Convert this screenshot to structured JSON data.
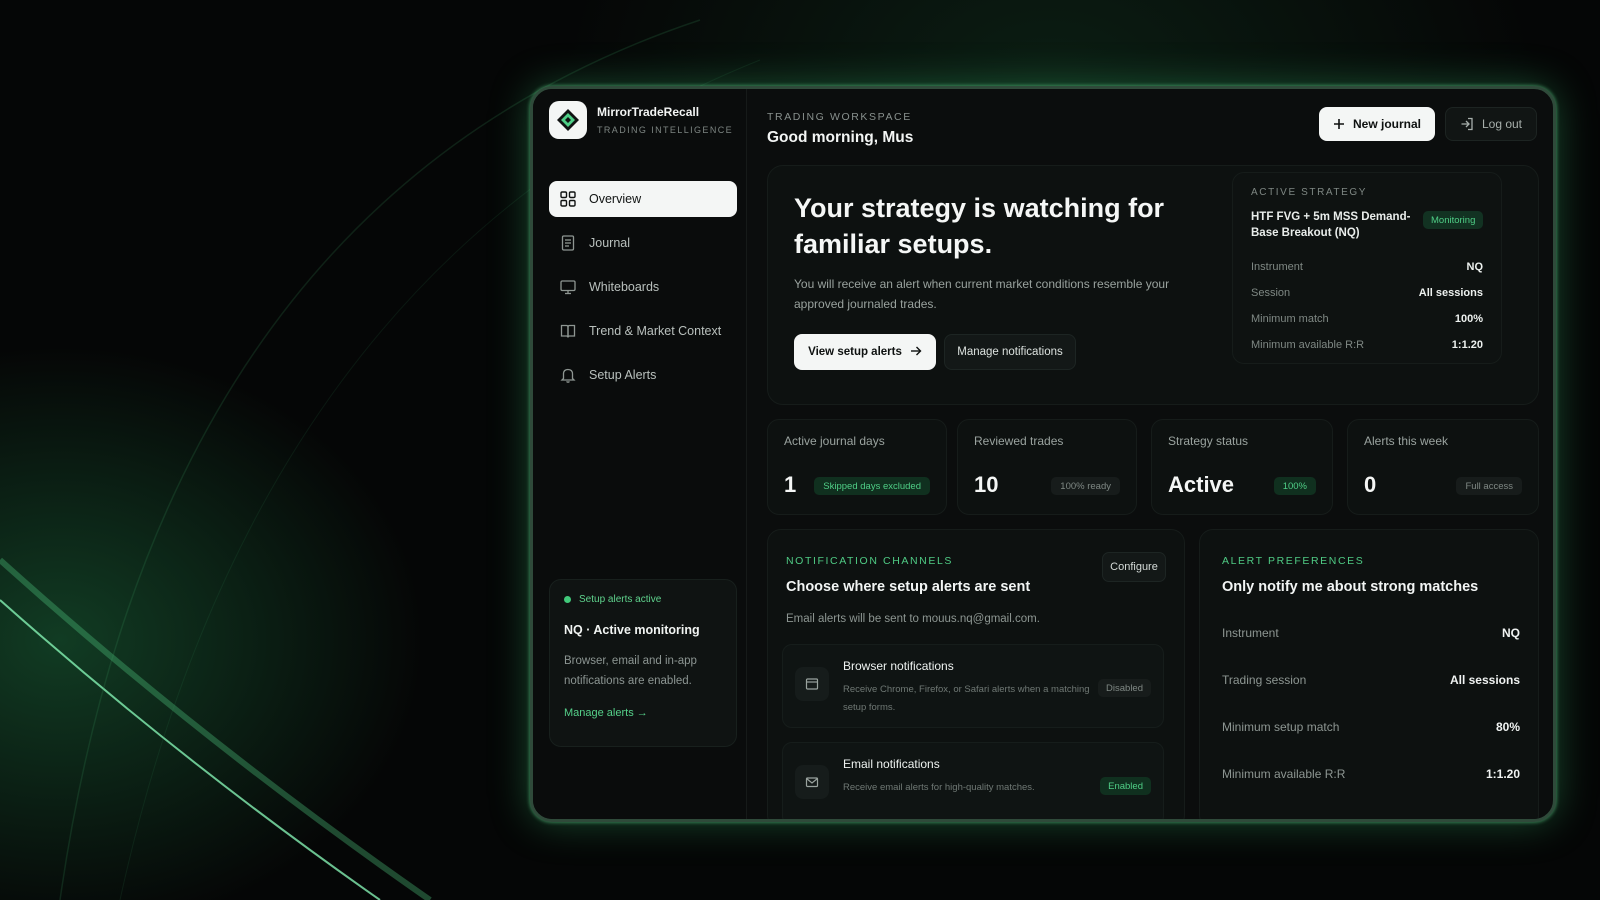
{
  "brand": {
    "name": "MirrorTradeRecall",
    "subtitle": "TRADING INTELLIGENCE"
  },
  "nav": [
    {
      "label": "Overview",
      "icon": "grid-icon",
      "active": true
    },
    {
      "label": "Journal",
      "icon": "document-icon"
    },
    {
      "label": "Whiteboards",
      "icon": "monitor-icon"
    },
    {
      "label": "Trend & Market Context",
      "icon": "book-icon"
    },
    {
      "label": "Setup Alerts",
      "icon": "bell-icon"
    }
  ],
  "side_card": {
    "status": "Setup alerts active",
    "title": "NQ · Active monitoring",
    "description": "Browser, email and in-app notifications are enabled.",
    "link": "Manage alerts →"
  },
  "header": {
    "workspace_label": "TRADING WORKSPACE",
    "greeting": "Good morning, Mus",
    "new_journal": "New journal",
    "logout": "Log out"
  },
  "hero": {
    "title": "Your strategy is watching for familiar setups.",
    "description": "You will receive an alert when current market conditions resemble your approved journaled trades.",
    "view_alerts": "View setup alerts",
    "manage_notifications": "Manage notifications"
  },
  "active_strategy": {
    "label": "ACTIVE STRATEGY",
    "name": "HTF FVG + 5m MSS Demand-Base Breakout (NQ)",
    "badge": "Monitoring",
    "rows": [
      {
        "label": "Instrument",
        "value": "NQ"
      },
      {
        "label": "Session",
        "value": "All sessions"
      },
      {
        "label": "Minimum match",
        "value": "100%"
      },
      {
        "label": "Minimum available R:R",
        "value": "1:1.20"
      }
    ]
  },
  "stats": [
    {
      "label": "Active journal days",
      "value": "1",
      "badge": "Skipped days excluded",
      "badge_style": "green"
    },
    {
      "label": "Reviewed trades",
      "value": "10",
      "badge": "100% ready",
      "badge_style": "gray"
    },
    {
      "label": "Strategy status",
      "value": "Active",
      "badge": "100%",
      "badge_style": "green"
    },
    {
      "label": "Alerts this week",
      "value": "0",
      "badge": "Full access",
      "badge_style": "gray"
    }
  ],
  "notifications": {
    "label": "NOTIFICATION CHANNELS",
    "title": "Choose where setup alerts are sent",
    "configure": "Configure",
    "description": "Email alerts will be sent to mouus.nq@gmail.com.",
    "channels": [
      {
        "title": "Browser notifications",
        "description": "Receive Chrome, Firefox, or Safari alerts when a matching setup forms.",
        "badge": "Disabled",
        "icon": "browser-icon"
      },
      {
        "title": "Email notifications",
        "description": "Receive email alerts for high-quality matches.",
        "badge": "Enabled",
        "icon": "mail-icon"
      }
    ]
  },
  "preferences": {
    "label": "ALERT PREFERENCES",
    "title": "Only notify me about strong matches",
    "rows": [
      {
        "label": "Instrument",
        "value": "NQ"
      },
      {
        "label": "Trading session",
        "value": "All sessions"
      },
      {
        "label": "Minimum setup match",
        "value": "80%"
      },
      {
        "label": "Minimum available R:R",
        "value": "1:1.20"
      }
    ]
  },
  "colors": {
    "accent": "#4fce86",
    "background": "#050606",
    "panel": "#0d1110"
  }
}
